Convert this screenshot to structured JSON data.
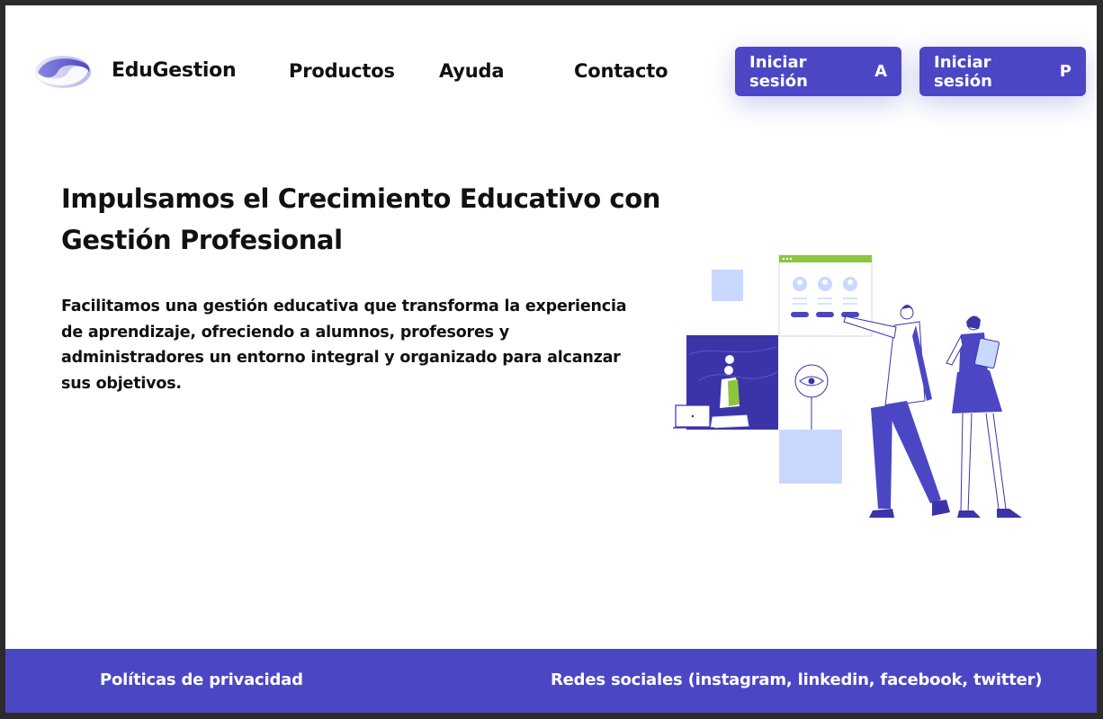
{
  "brand": {
    "name": "EduGestion"
  },
  "nav": {
    "items": [
      {
        "label": "Productos"
      },
      {
        "label": "Ayuda"
      },
      {
        "label": "Contacto"
      }
    ]
  },
  "auth": {
    "buttons": [
      {
        "label": "Iniciar sesión",
        "key": "A"
      },
      {
        "label": "Iniciar sesión",
        "key": "P"
      }
    ]
  },
  "hero": {
    "title": "Impulsamos el Crecimiento Educativo con Gestión Profesional",
    "description": "Facilitamos una gestión educativa que transforma la experiencia de aprendizaje, ofreciendo a alumnos, profesores y administradores un entorno integral y organizado para alcanzar sus objetivos."
  },
  "footer": {
    "privacy": "Políticas de privacidad",
    "social": "Redes sociales (instagram, linkedin, facebook, twitter)"
  },
  "colors": {
    "accent": "#4b47c4",
    "accent_light": "#c9d8ff",
    "accent_green": "#8cc63f",
    "text": "#111111",
    "background": "#ffffff"
  },
  "illustration": {
    "name": "team-dashboard-illustration"
  }
}
